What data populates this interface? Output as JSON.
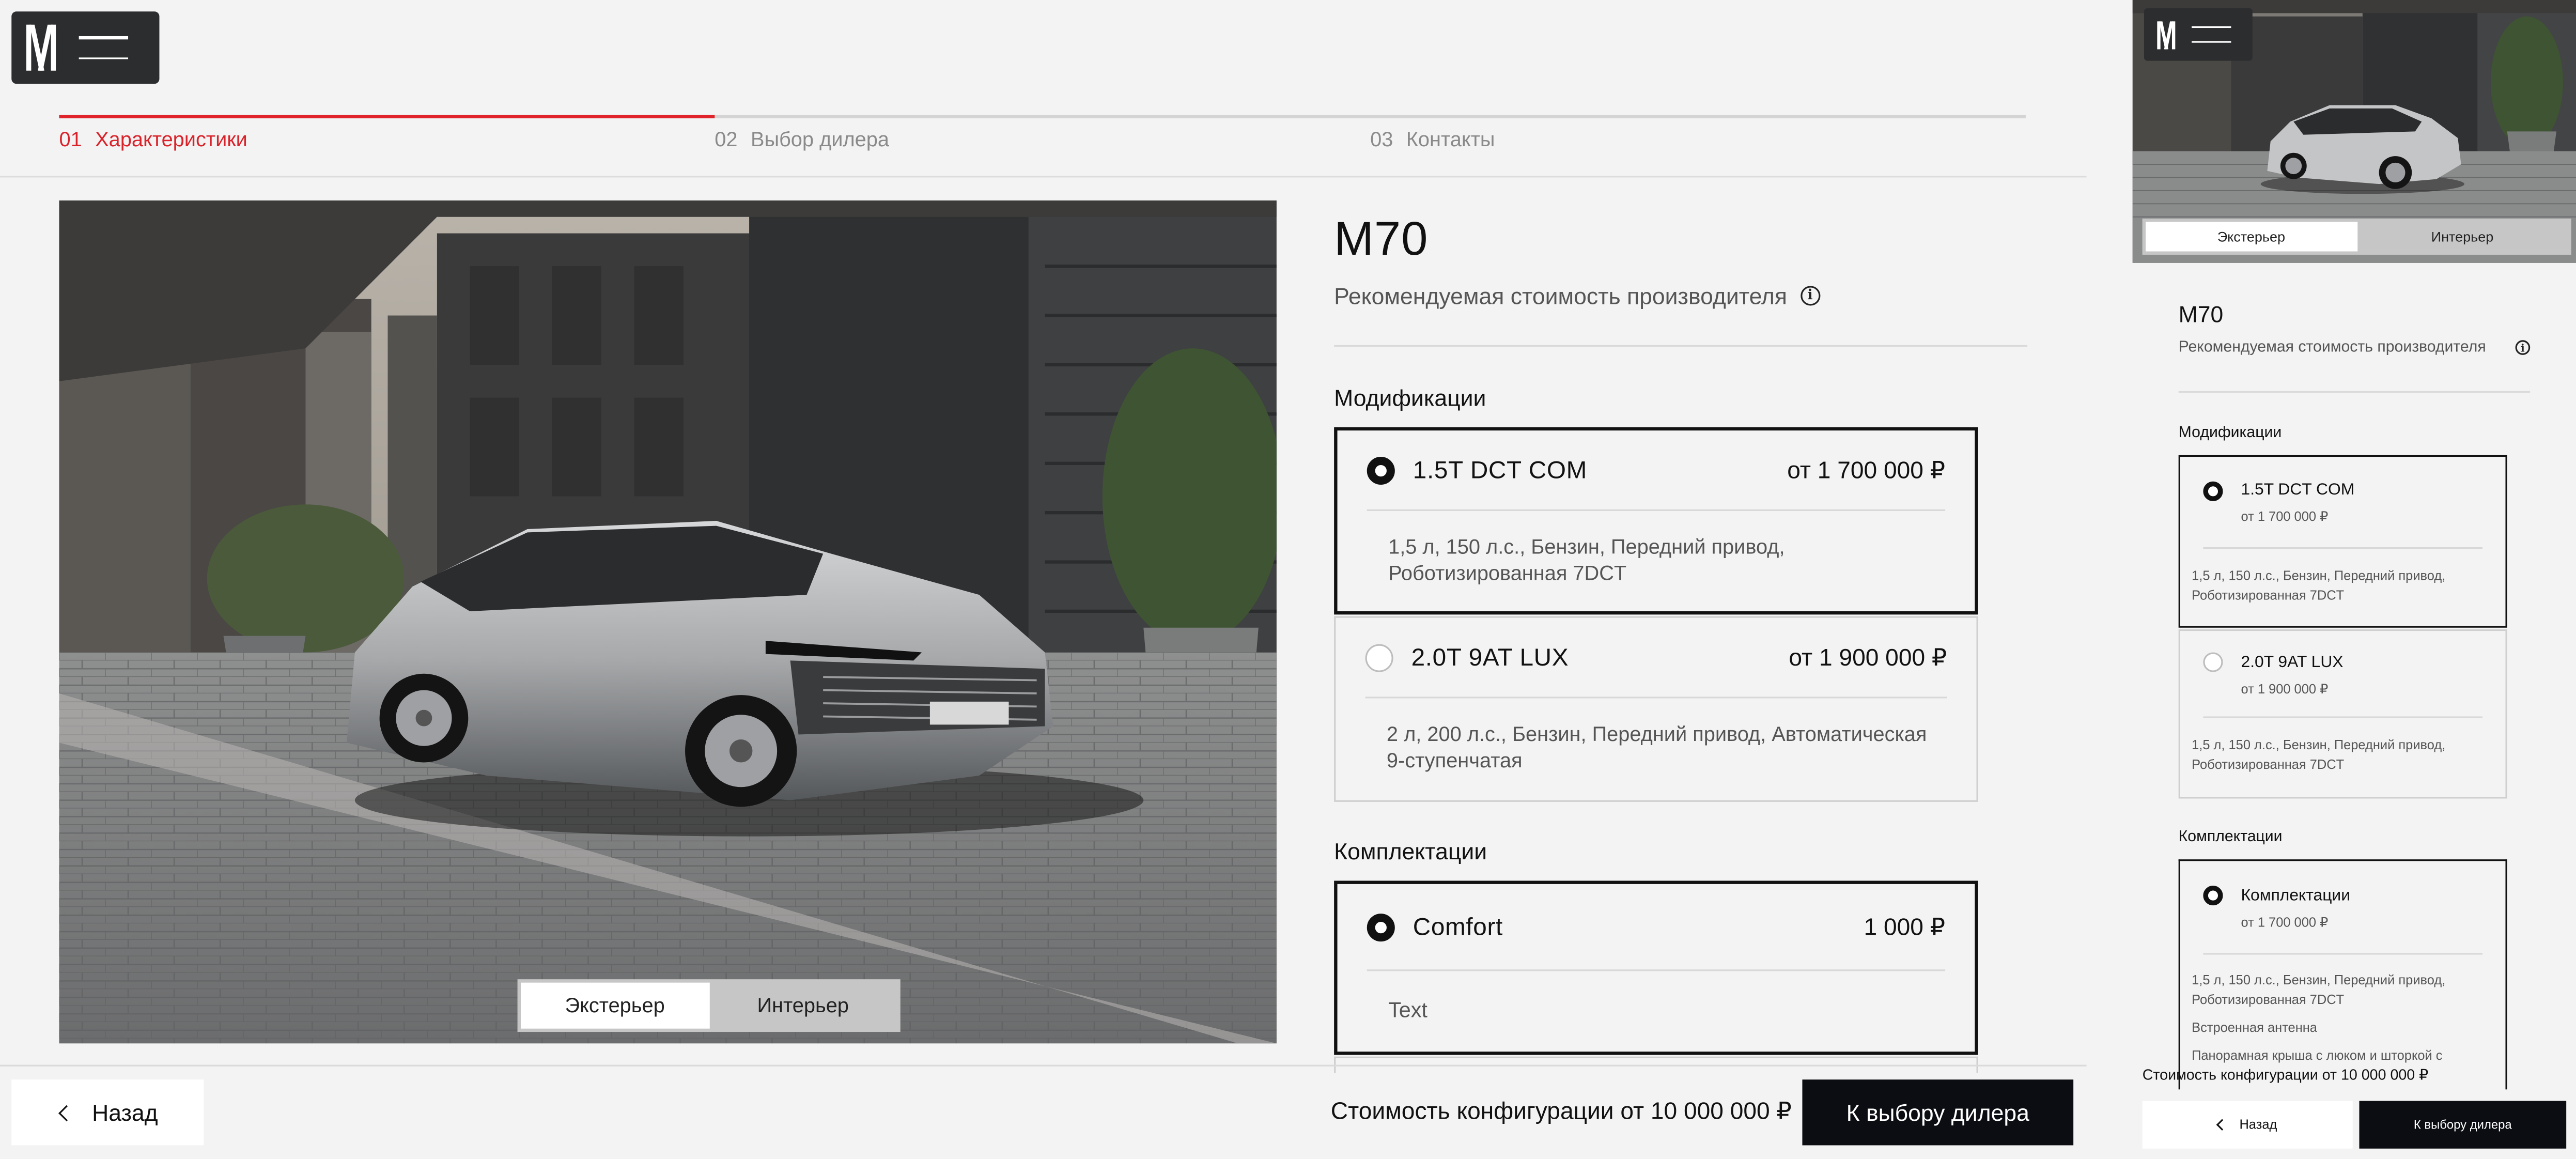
{
  "steps": [
    {
      "num": "01",
      "label": "Характеристики",
      "active": true
    },
    {
      "num": "02",
      "label": "Выбор дилера",
      "active": false
    },
    {
      "num": "03",
      "label": "Контакты",
      "active": false
    }
  ],
  "product": {
    "title": "M70",
    "price_note": "Рекомендуемая стоимость производителя"
  },
  "view_toggle": {
    "exterior": "Экстерьер",
    "interior": "Интерьер",
    "selected": "exterior"
  },
  "modifications": {
    "heading": "Модификации",
    "items": [
      {
        "name": "1.5T DCT COM",
        "price": "от 1 700 000 ₽",
        "desc": "1,5 л, 150 л.с., Бензин, Передний привод, Роботизированная 7DCT",
        "selected": true
      },
      {
        "name": "2.0T 9AT LUX",
        "price": "от 1 900 000 ₽",
        "desc": "2 л, 200 л.с., Бензин, Передний привод, Автоматическая 9-ступенчатая",
        "selected": false
      }
    ]
  },
  "trims": {
    "heading": "Комплектации",
    "items": [
      {
        "name": "Comfort",
        "price": "1 000 ₽",
        "desc": "Text",
        "selected": true
      }
    ]
  },
  "footer": {
    "back_label": "Назад",
    "cost_label": "Стоимость конфигурации от 10 000 000 ₽",
    "next_label": "К выбору дилера"
  },
  "mobile": {
    "title": "M70",
    "price_note": "Рекомендуемая стоимость производителя",
    "exterior": "Экстерьер",
    "interior": "Интерьер",
    "modifications_heading": "Модификации",
    "mods": [
      {
        "name": "1.5T DCT COM",
        "price": "от 1 700 000 ₽",
        "desc": "1,5 л, 150 л.с., Бензин, Передний привод, Роботизированная 7DCT"
      },
      {
        "name": "2.0T 9AT LUX",
        "price": "от 1 900 000 ₽",
        "desc": "1,5 л, 150 л.с., Бензин, Передний привод, Роботизированная 7DCT"
      }
    ],
    "trims_heading": "Комплектации",
    "trim": {
      "name": "Комплектации",
      "price": "от 1 700 000 ₽",
      "desc": "1,5 л, 150 л.с., Бензин, Передний привод, Роботизированная 7DCT",
      "feature1": "Встроенная антенна",
      "feature2": "Панорамная крыша с люком и шторкой с"
    },
    "cost_label": "Стоимость конфигурации от 10 000 000 ₽",
    "back_label": "Назад",
    "next_label": "К выбору дилера"
  },
  "colors": {
    "accent": "#e0232b",
    "dark": "#0c0d12",
    "logo_bg": "#2c2d2f"
  },
  "icons": [
    "logo-icon",
    "menu-icon",
    "info-icon",
    "chevron-left-icon",
    "radio-icon"
  ]
}
